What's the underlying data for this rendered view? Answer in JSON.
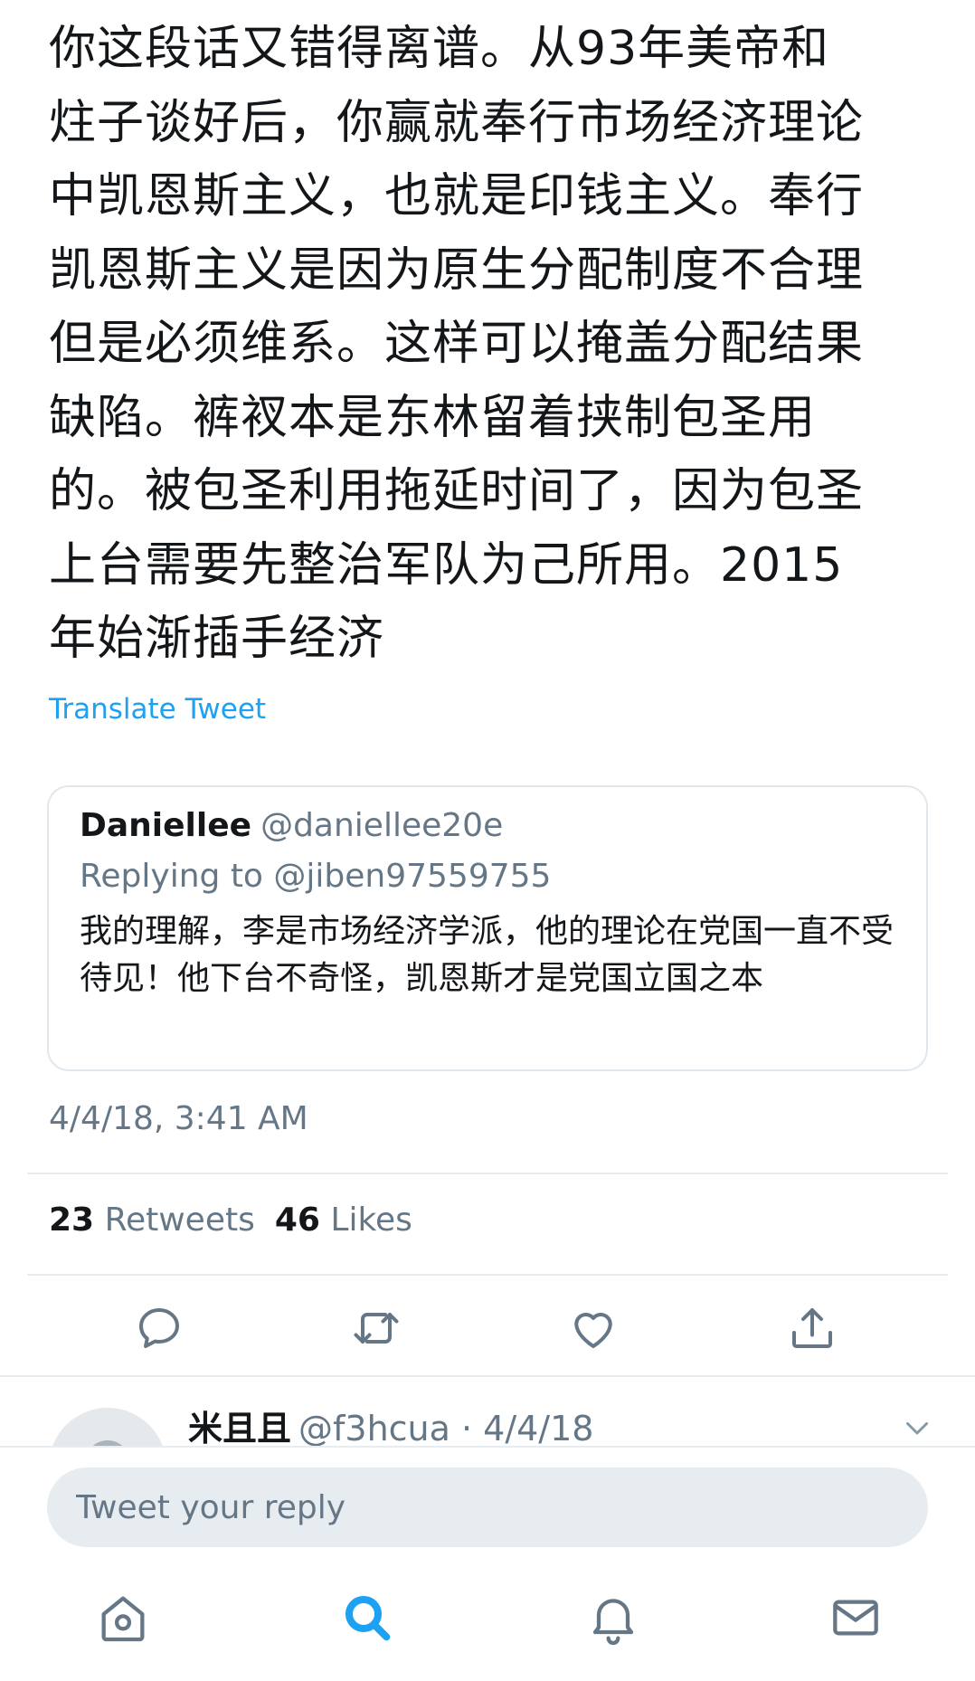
{
  "tweet": {
    "text": "你这段话又错得离谱。从93年美帝和\n炷子谈好后，你赢就奉行市场经济理论\n中凯恩斯主义，也就是印钱主义。奉行\n凯恩斯主义是因为原生分配制度不合理\n但是必须维系。这样可以掩盖分配结果\n缺陷。裤衩本是东林留着挟制包圣用\n的。被包圣利用拖延时间了，因为包圣\n上台需要先整治军队为己所用。2015\n年始渐插手经济",
    "translate_label": "Translate Tweet",
    "timestamp": "4/4/18, 3:41 AM"
  },
  "quoted": {
    "name": "Daniellee",
    "handle": "@daniellee20e",
    "replying_to": "Replying to @jiben97559755",
    "text": "我的理解，李是市场经济学派，他的理论在党国一直不受待见！他下台不奇怪，凯恩斯才是党国立国之本"
  },
  "stats": {
    "retweets_count": "23",
    "retweets_label": "Retweets",
    "likes_count": "46",
    "likes_label": "Likes"
  },
  "actions": {
    "icons": [
      "reply-icon",
      "retweet-icon",
      "like-icon",
      "share-icon"
    ],
    "color": "#657786"
  },
  "reply_preview": {
    "name": "米且且",
    "meta": "@f3hcua · 4/4/18"
  },
  "compose": {
    "placeholder": "Tweet your reply"
  },
  "tabbar": {
    "icons": [
      "home-icon",
      "search-icon",
      "notifications-icon",
      "messages-icon"
    ],
    "active": "search-icon",
    "active_color": "#1da1f2",
    "inactive_color": "#657786"
  }
}
